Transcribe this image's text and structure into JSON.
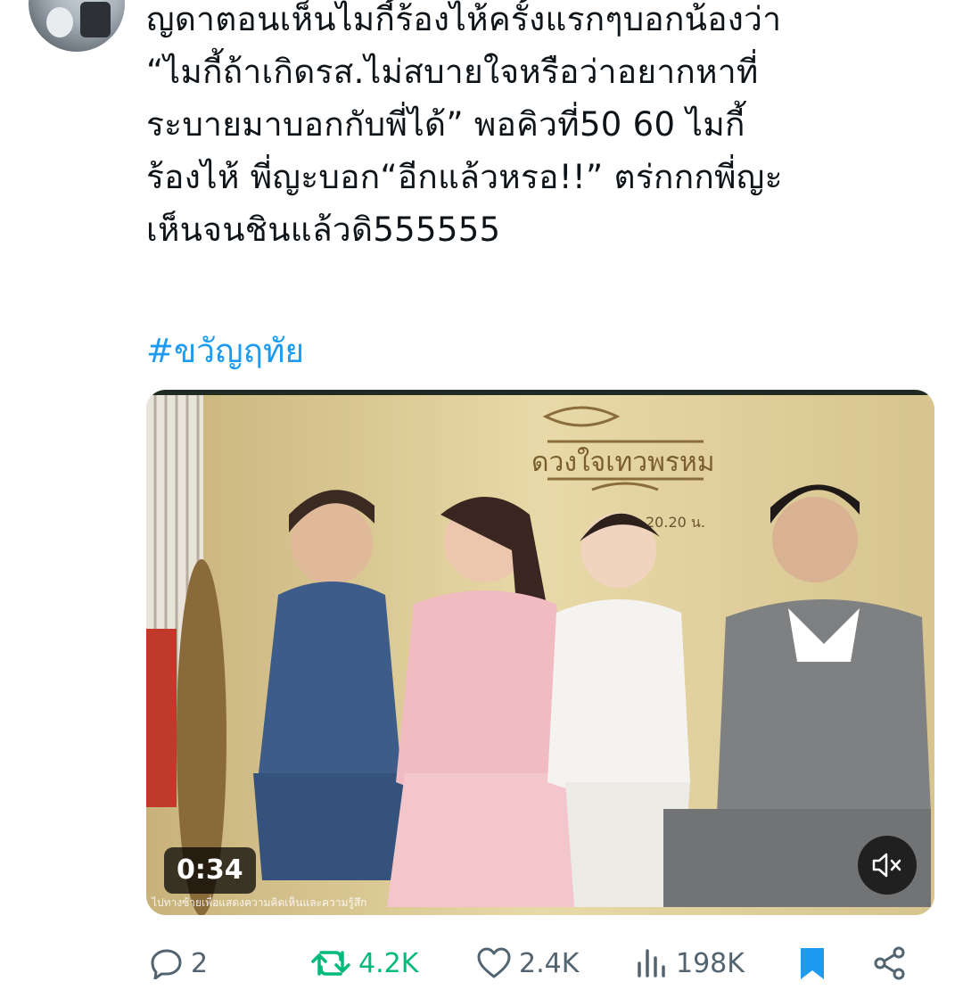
{
  "tweet": {
    "text": "ญดาตอนเห็นไมกี้ร้องไห้ครั้งแรกๆบอกน้องว่า\n“ไมกี้ถ้าเกิดรส.ไม่สบายใจหรือว่าอยากหาที่\nระบายมาบอกกับพี่ได้” พอคิวที่50 60 ไมกี้\nร้องไห้ พี่ญะบอก“อีกแล้วหรอ!!” ตร่กกกพี่ญะ\nเห็นจนชินแล้วดิ555555",
    "hashtag": "#ขวัญฤทัย"
  },
  "video": {
    "duration": "0:34",
    "title_logo": "ดวงใจเทวพรหม",
    "airtime": "20.20 น.",
    "caption": "ไปทางซ้ายเพื่อแสดงความคิดเห็นและความรู้สึก",
    "muted": true
  },
  "actions": {
    "reply_count": "2",
    "retweet_count": "4.2K",
    "like_count": "2.4K",
    "view_count": "198K",
    "bookmarked": true
  },
  "colors": {
    "link": "#1d9bf0",
    "retweet": "#00ba7c",
    "bookmark": "#1d9bf0",
    "muted_text": "#536471"
  },
  "icons": [
    "reply-icon",
    "retweet-icon",
    "like-icon",
    "views-icon",
    "bookmark-icon",
    "share-icon",
    "mute-icon"
  ]
}
